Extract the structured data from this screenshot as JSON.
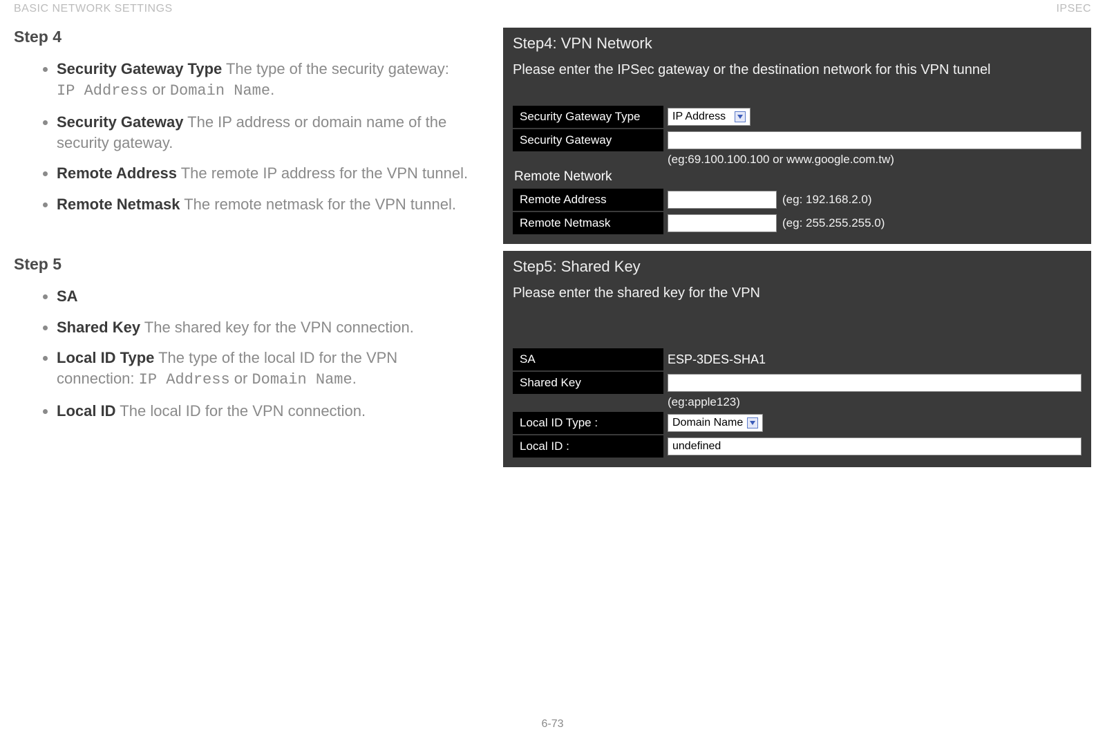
{
  "header": {
    "left": "BASIC NETWORK SETTINGS",
    "right": "IPSEC"
  },
  "footer": {
    "page": "6-73"
  },
  "left": {
    "step4": {
      "heading": "Step 4",
      "items": [
        {
          "term": "Security Gateway Type",
          "desc_pre": "  The type of the security gateway: ",
          "code1": "IP Address",
          "mid": " or ",
          "code2": "Domain Name",
          "tail": "."
        },
        {
          "term": "Security Gateway",
          "desc": "  The IP address or domain name of the security gateway."
        },
        {
          "term": "Remote Address",
          "desc": "  The remote IP address for the VPN tunnel."
        },
        {
          "term": "Remote Netmask",
          "desc": "  The remote netmask for the VPN tunnel."
        }
      ]
    },
    "step5": {
      "heading": "Step 5",
      "items": [
        {
          "term": "SA",
          "desc": ""
        },
        {
          "term": "Shared Key",
          "desc": "  The shared key for the VPN connection."
        },
        {
          "term": "Local ID Type",
          "desc_pre": "  The type of the local ID for the VPN connection: ",
          "code1": "IP Address",
          "mid": " or ",
          "code2": "Domain Name",
          "tail": "."
        },
        {
          "term": "Local ID",
          "desc": "  The local ID for the VPN connection."
        }
      ]
    }
  },
  "panel4": {
    "title": "Step4: VPN Network",
    "desc": "Please enter the IPSec gateway or the destination network for this VPN tunnel",
    "rows": {
      "sg_type_label": "Security Gateway Type",
      "sg_type_value": "IP Address",
      "sg_label": "Security Gateway",
      "sg_hint": "(eg:69.100.100.100 or www.google.com.tw)",
      "remote_network_label": "Remote Network",
      "remote_address_label": "Remote Address",
      "remote_address_hint": "(eg: 192.168.2.0)",
      "remote_netmask_label": "Remote Netmask",
      "remote_netmask_hint": "(eg: 255.255.255.0)"
    }
  },
  "panel5": {
    "title": "Step5: Shared Key",
    "desc": "Please enter the shared key for the VPN",
    "rows": {
      "sa_label": "SA",
      "sa_value": "ESP-3DES-SHA1",
      "shared_key_label": "Shared Key",
      "shared_key_hint": "(eg:apple123)",
      "local_id_type_label": "Local ID Type :",
      "local_id_type_value": "Domain Name",
      "local_id_label": "Local ID :",
      "local_id_value": "undefined"
    }
  }
}
